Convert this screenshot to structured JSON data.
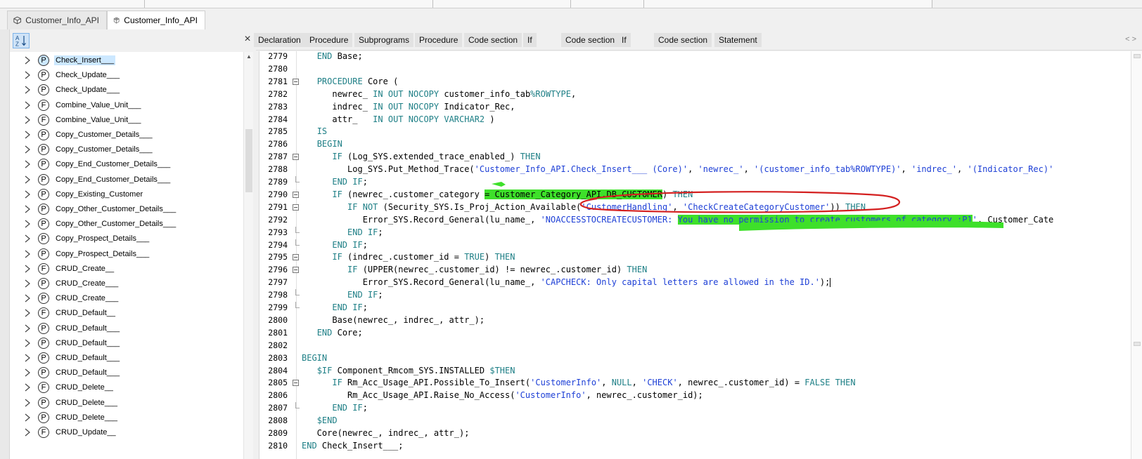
{
  "tabs": [
    {
      "label": "Customer_Info_API",
      "icon": "package-icon",
      "active": false
    },
    {
      "label": "Customer_Info_API",
      "icon": "package-body-icon",
      "active": true
    }
  ],
  "outline": {
    "sort_button_icon": "sort-az-icon",
    "items": [
      {
        "kind": "P",
        "label": "Check_Insert___",
        "selected": true
      },
      {
        "kind": "P",
        "label": "Check_Update___"
      },
      {
        "kind": "P",
        "label": "Check_Update___"
      },
      {
        "kind": "F",
        "label": "Combine_Value_Unit___"
      },
      {
        "kind": "F",
        "label": "Combine_Value_Unit___"
      },
      {
        "kind": "P",
        "label": "Copy_Customer_Details___"
      },
      {
        "kind": "P",
        "label": "Copy_Customer_Details___"
      },
      {
        "kind": "P",
        "label": "Copy_End_Customer_Details___"
      },
      {
        "kind": "P",
        "label": "Copy_End_Customer_Details___"
      },
      {
        "kind": "P",
        "label": "Copy_Existing_Customer"
      },
      {
        "kind": "P",
        "label": "Copy_Other_Customer_Details___"
      },
      {
        "kind": "P",
        "label": "Copy_Other_Customer_Details___"
      },
      {
        "kind": "P",
        "label": "Copy_Prospect_Details___"
      },
      {
        "kind": "P",
        "label": "Copy_Prospect_Details___"
      },
      {
        "kind": "F",
        "label": "CRUD_Create__"
      },
      {
        "kind": "P",
        "label": "CRUD_Create___"
      },
      {
        "kind": "P",
        "label": "CRUD_Create___"
      },
      {
        "kind": "F",
        "label": "CRUD_Default__"
      },
      {
        "kind": "P",
        "label": "CRUD_Default___"
      },
      {
        "kind": "P",
        "label": "CRUD_Default___"
      },
      {
        "kind": "P",
        "label": "CRUD_Default___"
      },
      {
        "kind": "P",
        "label": "CRUD_Default___"
      },
      {
        "kind": "F",
        "label": "CRUD_Delete__"
      },
      {
        "kind": "P",
        "label": "CRUD_Delete___"
      },
      {
        "kind": "P",
        "label": "CRUD_Delete___"
      },
      {
        "kind": "F",
        "label": "CRUD_Update__"
      }
    ]
  },
  "breadcrumbs": [
    "Declaration",
    "Procedure",
    "Subprograms",
    "Procedure",
    "Code section",
    "If",
    "Code section",
    "If",
    "Code section",
    "Statement"
  ],
  "nav_arrows": "< >",
  "code_lines": [
    {
      "n": "2779",
      "text": "   END Base;"
    },
    {
      "n": "2780",
      "text": ""
    },
    {
      "n": "2781",
      "text": "   PROCEDURE Core ("
    },
    {
      "n": "2782",
      "text": "      newrec_ IN OUT NOCOPY customer_info_tab%ROWTYPE,"
    },
    {
      "n": "2783",
      "text": "      indrec_ IN OUT NOCOPY Indicator_Rec,"
    },
    {
      "n": "2784",
      "text": "      attr_   IN OUT NOCOPY VARCHAR2 )"
    },
    {
      "n": "2785",
      "text": "   IS"
    },
    {
      "n": "2786",
      "text": "   BEGIN"
    },
    {
      "n": "2787",
      "text": "      IF (Log_SYS.extended_trace_enabled_) THEN"
    },
    {
      "n": "2788",
      "text": "         Log_SYS.Put_Method_Trace('Customer_Info_API.Check_Insert___ (Core)', 'newrec_', '(customer_info_tab%ROWTYPE)', 'indrec_', '(Indicator_Rec)'"
    },
    {
      "n": "2789",
      "text": "      END IF;"
    },
    {
      "n": "2790",
      "text": "      IF (newrec_.customer_category = Customer_Category_API.DB_CUSTOMER) THEN"
    },
    {
      "n": "2791",
      "text": "         IF NOT (Security_SYS.Is_Proj_Action_Available('CustomerHandling', 'CheckCreateCategoryCustomer')) THEN"
    },
    {
      "n": "2792",
      "text": "            Error_SYS.Record_General(lu_name_, 'NOACCESSTOCREATECUSTOMER: You have no permission to create customers of category :P1', Customer_Cate"
    },
    {
      "n": "2793",
      "text": "         END IF;"
    },
    {
      "n": "2794",
      "text": "      END IF;"
    },
    {
      "n": "2795",
      "text": "      IF (indrec_.customer_id = TRUE) THEN"
    },
    {
      "n": "2796",
      "text": "         IF (UPPER(newrec_.customer_id) != newrec_.customer_id) THEN"
    },
    {
      "n": "2797",
      "text": "            Error_SYS.Record_General(lu_name_, 'CAPCHECK: Only capital letters are allowed in the ID.');"
    },
    {
      "n": "2798",
      "text": "         END IF;"
    },
    {
      "n": "2799",
      "text": "      END IF;"
    },
    {
      "n": "2800",
      "text": "      Base(newrec_, indrec_, attr_);"
    },
    {
      "n": "2801",
      "text": "   END Core;"
    },
    {
      "n": "2802",
      "text": ""
    },
    {
      "n": "2803",
      "text": "BEGIN"
    },
    {
      "n": "2804",
      "text": "   $IF Component_Rmcom_SYS.INSTALLED $THEN"
    },
    {
      "n": "2805",
      "text": "      IF Rm_Acc_Usage_API.Possible_To_Insert('CustomerInfo', NULL, 'CHECK', newrec_.customer_id) = FALSE THEN"
    },
    {
      "n": "2806",
      "text": "         Rm_Acc_Usage_API.Raise_No_Access('CustomerInfo', newrec_.customer_id);"
    },
    {
      "n": "2807",
      "text": "      END IF;"
    },
    {
      "n": "2808",
      "text": "   $END"
    },
    {
      "n": "2809",
      "text": "   Core(newrec_, indrec_, attr_);"
    },
    {
      "n": "2810",
      "text": "END Check_Insert___;"
    }
  ],
  "colors": {
    "keyword": "#1e7f86",
    "string": "#1d3fd6",
    "highlight": "#3ee02a",
    "circle": "#d42020",
    "selection": "#cce8ff"
  }
}
